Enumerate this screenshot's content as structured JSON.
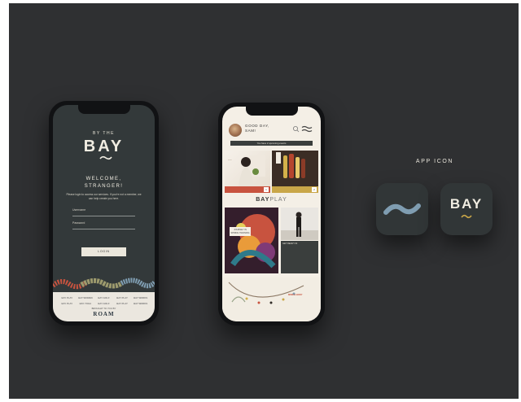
{
  "phone1": {
    "brand_small": "BY THE",
    "brand": "BAY",
    "welcome_line1": "WELCOME,",
    "welcome_line2": "STRANGER!",
    "message": "Please login to access our services. If you're not a member, we can help create you here.",
    "username_placeholder": "Username",
    "password_placeholder": "Password",
    "login_label": "LOGIN",
    "partner_logos": [
      "BAY PLAY",
      "BAY WOMEN",
      "BAY GOLF",
      "BAY PLAY",
      "BAY WORKS",
      "BAY PLAY",
      "BAY YOGA",
      "BAY GOLF",
      "BAY PLAY",
      "BAY WORKS"
    ],
    "powered_by": "BROUGHT TO YOU BY",
    "roam": "ROAM",
    "colors": {
      "bg": "#33393a",
      "cream": "#ebe7dc",
      "accent_red": "#c8533f",
      "accent_olive": "#9d9a6d",
      "accent_blue": "#7f9db1"
    }
  },
  "phone2": {
    "greeting_line1": "GOOD DAY,",
    "greeting_line2": "SAM!",
    "upcoming_bar": "You have 2 upcoming events",
    "tile1_num": "1",
    "tile2_num": "2",
    "bayplay_bold": "BAY",
    "bayplay_light": "PLAY",
    "left_caption": "JOURNEY IN SPRING TRAINING",
    "right_caption": "GET READY IN",
    "bottom_caption": "MIND & BODY",
    "colors": {
      "bg": "#f4efe6",
      "dark": "#3a3e3d",
      "accent_red": "#c8533f",
      "accent_gold": "#c9a648"
    }
  },
  "app_icon": {
    "title": "APP ICON",
    "bay_text": "BAY",
    "colors": {
      "tile": "#313637",
      "wave_blue": "#7f9db1",
      "wave_gold": "#c9a648"
    }
  },
  "icons": [
    "wave-logo-icon",
    "avatar-icon",
    "search-icon",
    "menu-wave-icon"
  ]
}
